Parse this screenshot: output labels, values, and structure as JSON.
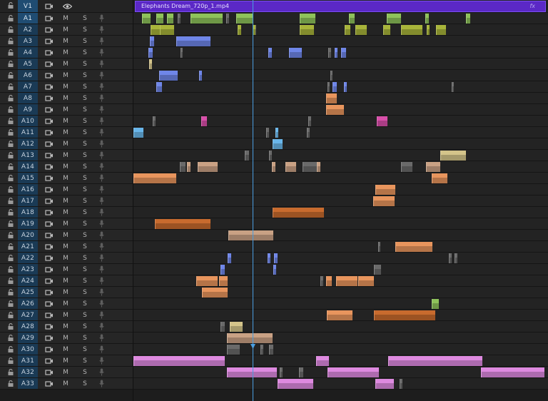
{
  "video_track": {
    "label": "V1",
    "clip_name": "Elephants Dream_720p_1.mp4",
    "fx_badge": "fx"
  },
  "audio_tracks": [
    "A1",
    "A2",
    "A3",
    "A4",
    "A5",
    "A6",
    "A7",
    "A8",
    "A9",
    "A10",
    "A11",
    "A12",
    "A13",
    "A14",
    "A15",
    "A16",
    "A17",
    "A18",
    "A19",
    "A20",
    "A21",
    "A22",
    "A23",
    "A24",
    "A25",
    "A26",
    "A27",
    "A28",
    "A29",
    "A30",
    "A31",
    "A32",
    "A33"
  ],
  "track_buttons": {
    "mute": "M",
    "solo": "S"
  },
  "colors": {
    "green": "#8ec25a",
    "olive": "#a8b43a",
    "blue": "#6f86e8",
    "lightblue": "#69b6ea",
    "peach": "#e8955d",
    "brown": "#c86b2e",
    "magenta": "#d94faa",
    "pink": "#de8ae0",
    "tan": "#c9a184",
    "khaki": "#d4c48a",
    "gray": "#6a6a6a",
    "purple_video": "#5b28c6",
    "playhead": "#4a9ee0"
  }
}
